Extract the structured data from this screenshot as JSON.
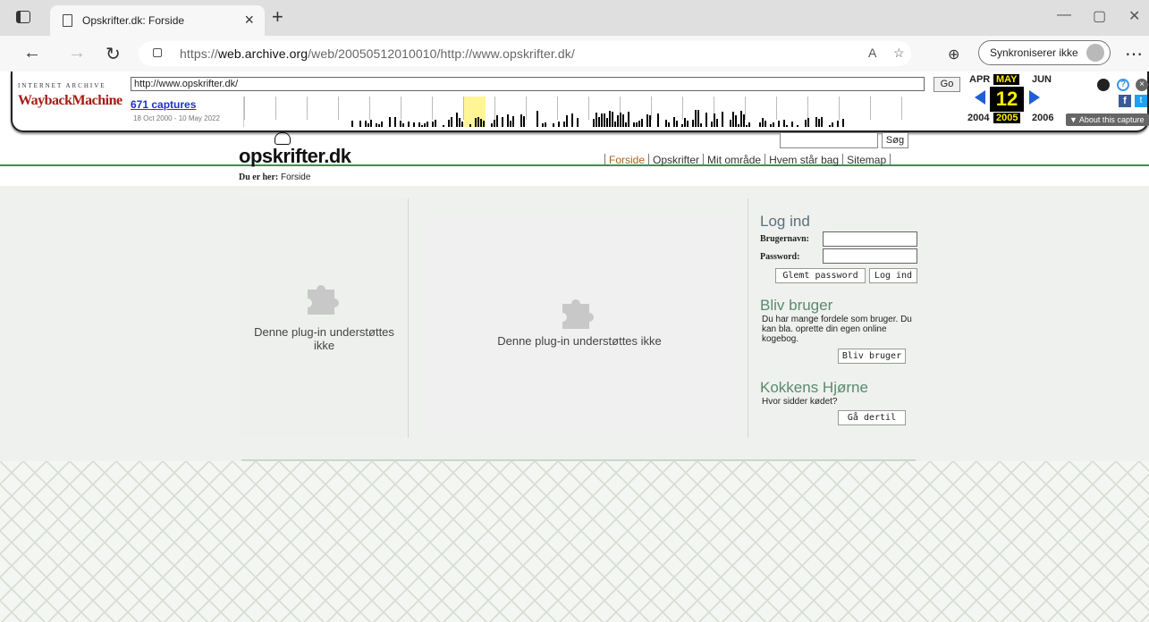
{
  "browser": {
    "tab_title": "Opskrifter.dk: Forside",
    "url_prefix": "https://",
    "url_host": "web.archive.org",
    "url_path": "/web/20050512010010/http://www.opskrifter.dk/",
    "sync_label": "Synkroniserer ikke"
  },
  "wayback": {
    "ia_label": "INTERNET ARCHIVE",
    "logo_text": "WaybackMachine",
    "url_value": "http://www.opskrifter.dk/",
    "go_label": "Go",
    "captures": "671 captures",
    "range": "18 Oct 2000 - 10 May 2022",
    "months": {
      "prev": "APR",
      "cur": "MAY",
      "next": "JUN"
    },
    "day": "12",
    "years": {
      "prev": "2004",
      "cur": "2005",
      "next": "2006"
    },
    "about_label": "▼ About this capture"
  },
  "site": {
    "logo": "opskrifter.dk",
    "search_button": "Søg",
    "nav": [
      "Forside",
      "Opskrifter",
      "Mit område",
      "Hvem står bag",
      "Sitemap"
    ],
    "breadcrumb_label": "Du er her:",
    "breadcrumb_value": "Forside"
  },
  "plugins": {
    "left_text": "Denne plug-in understøttes ikke",
    "mid_text": "Denne plug-in understøttes ikke"
  },
  "login": {
    "heading": "Log ind",
    "username_label": "Brugernavn:",
    "password_label": "Password:",
    "forgot_button": "Glemt password",
    "login_button": "Log ind"
  },
  "signup": {
    "heading": "Bliv bruger",
    "text": "Du har mange fordele som bruger. Du kan bla. oprette din egen online kogebog.",
    "button": "Bliv bruger"
  },
  "kokkens": {
    "heading": "Kokkens Hjørne",
    "text": "Hvor sidder kødet?",
    "button": "Gå dertil"
  }
}
